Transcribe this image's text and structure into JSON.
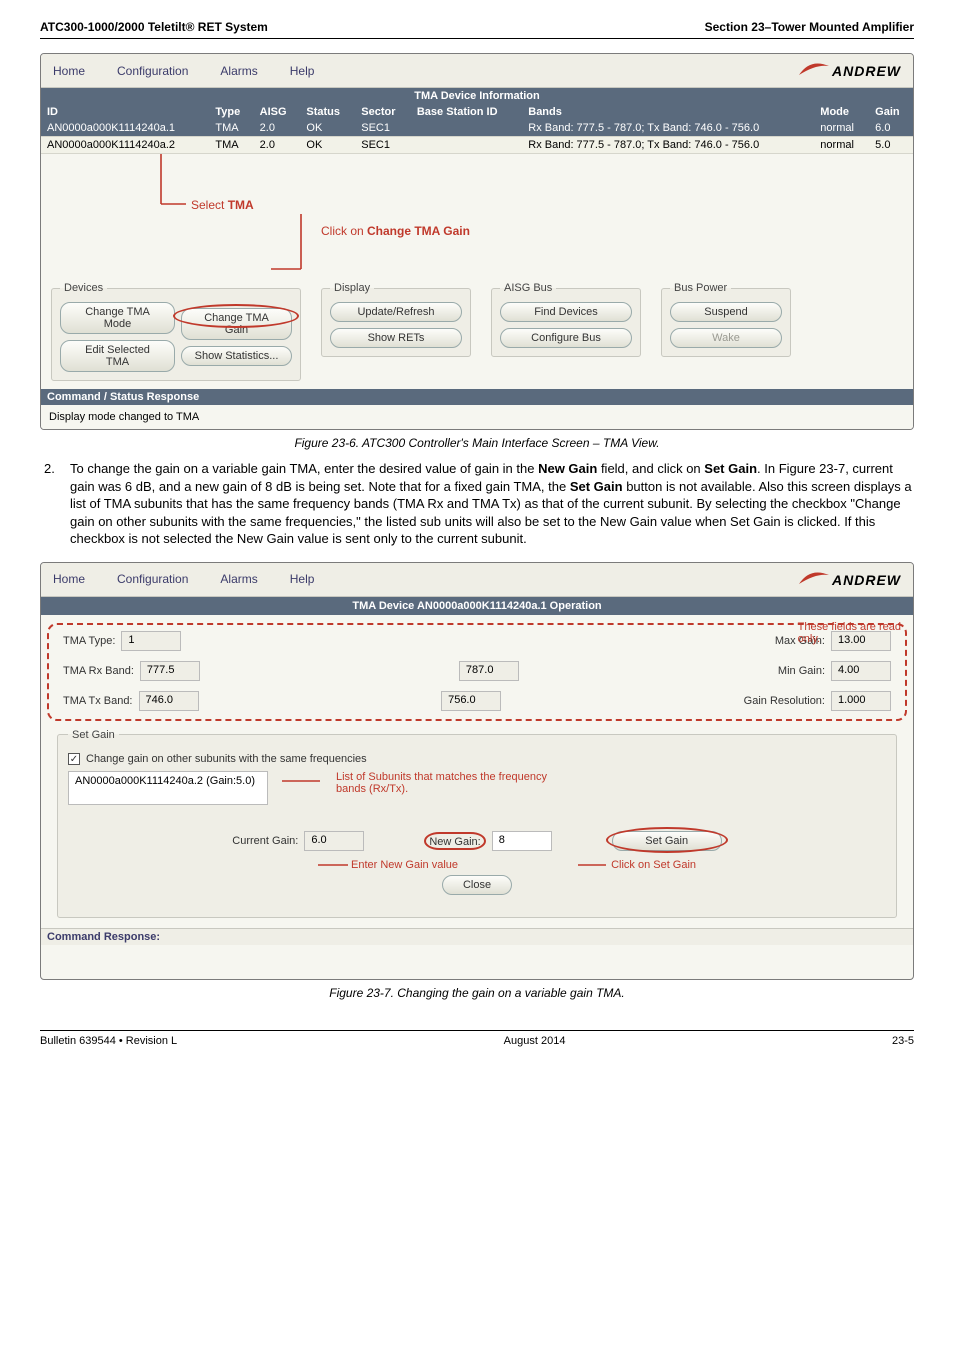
{
  "doc": {
    "header_left": "ATC300-1000/2000 Teletilt® RET System",
    "header_right": "Section 23–Tower Mounted Amplifier",
    "footer_left": "Bulletin 639544  •  Revision L",
    "footer_center": "August 2014",
    "footer_right": "23-5"
  },
  "menu": {
    "home": "Home",
    "configuration": "Configuration",
    "alarms": "Alarms",
    "help": "Help",
    "andrew": "ANDREW"
  },
  "shot1": {
    "info_title": "TMA Device Information",
    "headers": {
      "id": "ID",
      "type": "Type",
      "aisg": "AISG",
      "status": "Status",
      "sector": "Sector",
      "base": "Base Station ID",
      "bands": "Bands",
      "mode": "Mode",
      "gain": "Gain"
    },
    "rows": [
      {
        "id": "AN0000a000K1114240a.1",
        "type": "TMA",
        "aisg": "2.0",
        "status": "OK",
        "sector": "SEC1",
        "base": "",
        "bands": "Rx Band: 777.5 - 787.0; Tx Band: 746.0 - 756.0",
        "mode": "normal",
        "gain": "6.0",
        "selected": true
      },
      {
        "id": "AN0000a000K1114240a.2",
        "type": "TMA",
        "aisg": "2.0",
        "status": "OK",
        "sector": "SEC1",
        "base": "",
        "bands": "Rx Band: 777.5 - 787.0; Tx Band: 746.0 - 756.0",
        "mode": "normal",
        "gain": "5.0",
        "selected": false
      }
    ],
    "callouts": {
      "select_tma_pre": "Select ",
      "select_tma_bold": "TMA",
      "click_change_pre": "Click on ",
      "click_change_bold": "Change TMA Gain"
    },
    "panels": {
      "devices": "Devices",
      "display": "Display",
      "aisg_bus": "AISG Bus",
      "bus_power": "Bus Power"
    },
    "buttons": {
      "change_mode": "Change TMA Mode",
      "edit_sel": "Edit Selected TMA",
      "change_gain": "Change TMA Gain",
      "show_stats": "Show Statistics...",
      "update": "Update/Refresh",
      "show_rets": "Show RETs",
      "find_dev": "Find Devices",
      "config_bus": "Configure Bus",
      "suspend": "Suspend",
      "wake": "Wake"
    },
    "cmd_title": "Command / Status Response",
    "cmd_text": "Display mode changed to TMA",
    "caption": "Figure 23-6.  ATC300 Controller's Main Interface Screen – TMA View."
  },
  "para": {
    "num": "2.",
    "text_1": "To change the gain on a variable gain TMA, enter the desired value of gain in the ",
    "b1": "New Gain",
    "text_2": " field, and click on ",
    "b2": "Set Gain",
    "text_3": ". In Figure 23-7, current gain was 6 dB, and a new gain of 8 dB is being set. Note that for a fixed gain TMA, the ",
    "b3": "Set Gain",
    "text_4": " button is not available. Also this screen displays a list of TMA subunits that has the same frequency bands (TMA Rx and TMA Tx) as that of the current subunit. By selecting the checkbox \"Change gain on other subunits with the same frequencies,\" the listed sub units will also be set to the New Gain value when Set Gain is clicked. If this checkbox is not selected the New Gain value is sent only to the current subunit."
  },
  "shot2": {
    "op_title": "TMA Device AN0000a000K1114240a.1 Operation",
    "labels": {
      "tma_type": "TMA Type:",
      "tma_rx": "TMA Rx Band:",
      "tma_tx": "TMA Tx Band:",
      "max_gain": "Max Gain:",
      "min_gain": "Min Gain:",
      "gain_res": "Gain Resolution:",
      "current_gain": "Current Gain:",
      "new_gain": "New Gain:"
    },
    "values": {
      "tma_type": "1",
      "tma_rx": "777.5",
      "tma_tx": "746.0",
      "rx2": "787.0",
      "tx2": "756.0",
      "max_gain": "13.00",
      "min_gain": "4.00",
      "gain_res": "1.000",
      "current_gain": "6.0",
      "new_gain": "8"
    },
    "setgain": {
      "title": "Set Gain",
      "checkbox": "Change gain on other subunits with the same frequencies",
      "list_item": "AN0000a000K1114240a.2 (Gain:5.0)"
    },
    "callouts": {
      "read_only_1": "These fields are read",
      "read_only_2": "only.",
      "list_desc_1": "List of Subunits that matches the frequency",
      "list_desc_2": "bands (Rx/Tx).",
      "enter_new": "Enter New Gain value",
      "click_set": "Click on Set Gain"
    },
    "buttons": {
      "set_gain": "Set Gain",
      "close": "Close"
    },
    "cmd_title": "Command Response:",
    "caption": "Figure 23-7.  Changing the gain on a variable gain TMA."
  }
}
